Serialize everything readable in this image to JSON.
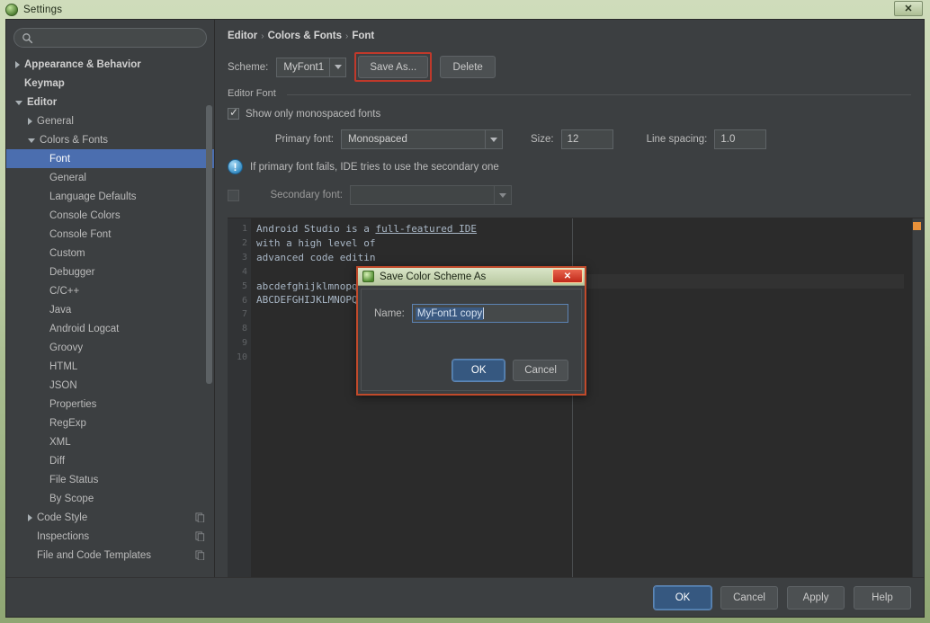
{
  "os_window": {
    "title": "Settings",
    "icon": "android-studio-icon",
    "close_label": "✕"
  },
  "search": {
    "placeholder": "",
    "value": "",
    "icon": "search-icon"
  },
  "sidebar": {
    "items": [
      {
        "label": "Appearance & Behavior",
        "indent": 0,
        "arrow": "closed",
        "bold": true,
        "selected": false,
        "icon": ""
      },
      {
        "label": "Keymap",
        "indent": 0,
        "arrow": "none",
        "bold": true,
        "selected": false,
        "icon": ""
      },
      {
        "label": "Editor",
        "indent": 0,
        "arrow": "open",
        "bold": true,
        "selected": false,
        "icon": ""
      },
      {
        "label": "General",
        "indent": 1,
        "arrow": "closed",
        "bold": false,
        "selected": false,
        "icon": ""
      },
      {
        "label": "Colors & Fonts",
        "indent": 1,
        "arrow": "open",
        "bold": false,
        "selected": false,
        "icon": ""
      },
      {
        "label": "Font",
        "indent": 2,
        "arrow": "none",
        "bold": false,
        "selected": true,
        "icon": ""
      },
      {
        "label": "General",
        "indent": 2,
        "arrow": "none",
        "bold": false,
        "selected": false,
        "icon": ""
      },
      {
        "label": "Language Defaults",
        "indent": 2,
        "arrow": "none",
        "bold": false,
        "selected": false,
        "icon": ""
      },
      {
        "label": "Console Colors",
        "indent": 2,
        "arrow": "none",
        "bold": false,
        "selected": false,
        "icon": ""
      },
      {
        "label": "Console Font",
        "indent": 2,
        "arrow": "none",
        "bold": false,
        "selected": false,
        "icon": ""
      },
      {
        "label": "Custom",
        "indent": 2,
        "arrow": "none",
        "bold": false,
        "selected": false,
        "icon": ""
      },
      {
        "label": "Debugger",
        "indent": 2,
        "arrow": "none",
        "bold": false,
        "selected": false,
        "icon": ""
      },
      {
        "label": "C/C++",
        "indent": 2,
        "arrow": "none",
        "bold": false,
        "selected": false,
        "icon": ""
      },
      {
        "label": "Java",
        "indent": 2,
        "arrow": "none",
        "bold": false,
        "selected": false,
        "icon": ""
      },
      {
        "label": "Android Logcat",
        "indent": 2,
        "arrow": "none",
        "bold": false,
        "selected": false,
        "icon": ""
      },
      {
        "label": "Groovy",
        "indent": 2,
        "arrow": "none",
        "bold": false,
        "selected": false,
        "icon": ""
      },
      {
        "label": "HTML",
        "indent": 2,
        "arrow": "none",
        "bold": false,
        "selected": false,
        "icon": ""
      },
      {
        "label": "JSON",
        "indent": 2,
        "arrow": "none",
        "bold": false,
        "selected": false,
        "icon": ""
      },
      {
        "label": "Properties",
        "indent": 2,
        "arrow": "none",
        "bold": false,
        "selected": false,
        "icon": ""
      },
      {
        "label": "RegExp",
        "indent": 2,
        "arrow": "none",
        "bold": false,
        "selected": false,
        "icon": ""
      },
      {
        "label": "XML",
        "indent": 2,
        "arrow": "none",
        "bold": false,
        "selected": false,
        "icon": ""
      },
      {
        "label": "Diff",
        "indent": 2,
        "arrow": "none",
        "bold": false,
        "selected": false,
        "icon": ""
      },
      {
        "label": "File Status",
        "indent": 2,
        "arrow": "none",
        "bold": false,
        "selected": false,
        "icon": ""
      },
      {
        "label": "By Scope",
        "indent": 2,
        "arrow": "none",
        "bold": false,
        "selected": false,
        "icon": ""
      },
      {
        "label": "Code Style",
        "indent": 1,
        "arrow": "closed",
        "bold": false,
        "selected": false,
        "icon": "copy-scheme-icon"
      },
      {
        "label": "Inspections",
        "indent": 1,
        "arrow": "none",
        "bold": false,
        "selected": false,
        "icon": "copy-scheme-icon"
      },
      {
        "label": "File and Code Templates",
        "indent": 1,
        "arrow": "none",
        "bold": false,
        "selected": false,
        "icon": "copy-scheme-icon"
      }
    ]
  },
  "breadcrumb": {
    "part1": "Editor",
    "sep1": "›",
    "part2": "Colors & Fonts",
    "sep2": "›",
    "part3": "Font"
  },
  "scheme_row": {
    "label": "Scheme:",
    "value": "MyFont1",
    "save_as_label": "Save As...",
    "delete_label": "Delete",
    "highlight_color": "#c0392b"
  },
  "editor_font": {
    "group_title": "Editor Font",
    "monospaced_label": "Show only monospaced fonts",
    "monospaced_checked": true,
    "primary_font_label": "Primary font:",
    "primary_font_value": "Monospaced",
    "size_label": "Size:",
    "size_value": "12",
    "line_spacing_label": "Line spacing:",
    "line_spacing_value": "1.0",
    "info_text": "If primary font fails, IDE tries to use the secondary one",
    "info_icon": "info-icon",
    "secondary_font_label": "Secondary font:",
    "secondary_font_value": "",
    "secondary_checked": false
  },
  "preview": {
    "line_numbers": [
      "1",
      "2",
      "3",
      "4",
      "5",
      "6",
      "7",
      "8",
      "9",
      "10"
    ],
    "lines": [
      {
        "plain": "Android Studio is a ",
        "underlined": "full-featured IDE"
      },
      {
        "plain": "with a high level of",
        "underlined": ""
      },
      {
        "plain": "advanced code editin",
        "underlined": ""
      },
      {
        "plain": "",
        "underlined": ""
      },
      {
        "plain": "abcdefghijklmnopqrs",
        "underlined": ""
      },
      {
        "plain": "ABCDEFGHIJKLMNOPQRS",
        "underlined": ""
      },
      {
        "plain": "",
        "underlined": ""
      },
      {
        "plain": "",
        "underlined": ""
      },
      {
        "plain": "",
        "underlined": ""
      },
      {
        "plain": "",
        "underlined": ""
      }
    ],
    "marker_color": "#e8913a"
  },
  "bottom_bar": {
    "ok": "OK",
    "cancel": "Cancel",
    "apply": "Apply",
    "help": "Help"
  },
  "dialog": {
    "title": "Save Color Scheme As",
    "icon": "android-studio-icon",
    "close_label": "✕",
    "name_label": "Name:",
    "name_value": "MyFont1 copy",
    "ok": "OK",
    "cancel": "Cancel",
    "border_color": "#c04a2b"
  }
}
